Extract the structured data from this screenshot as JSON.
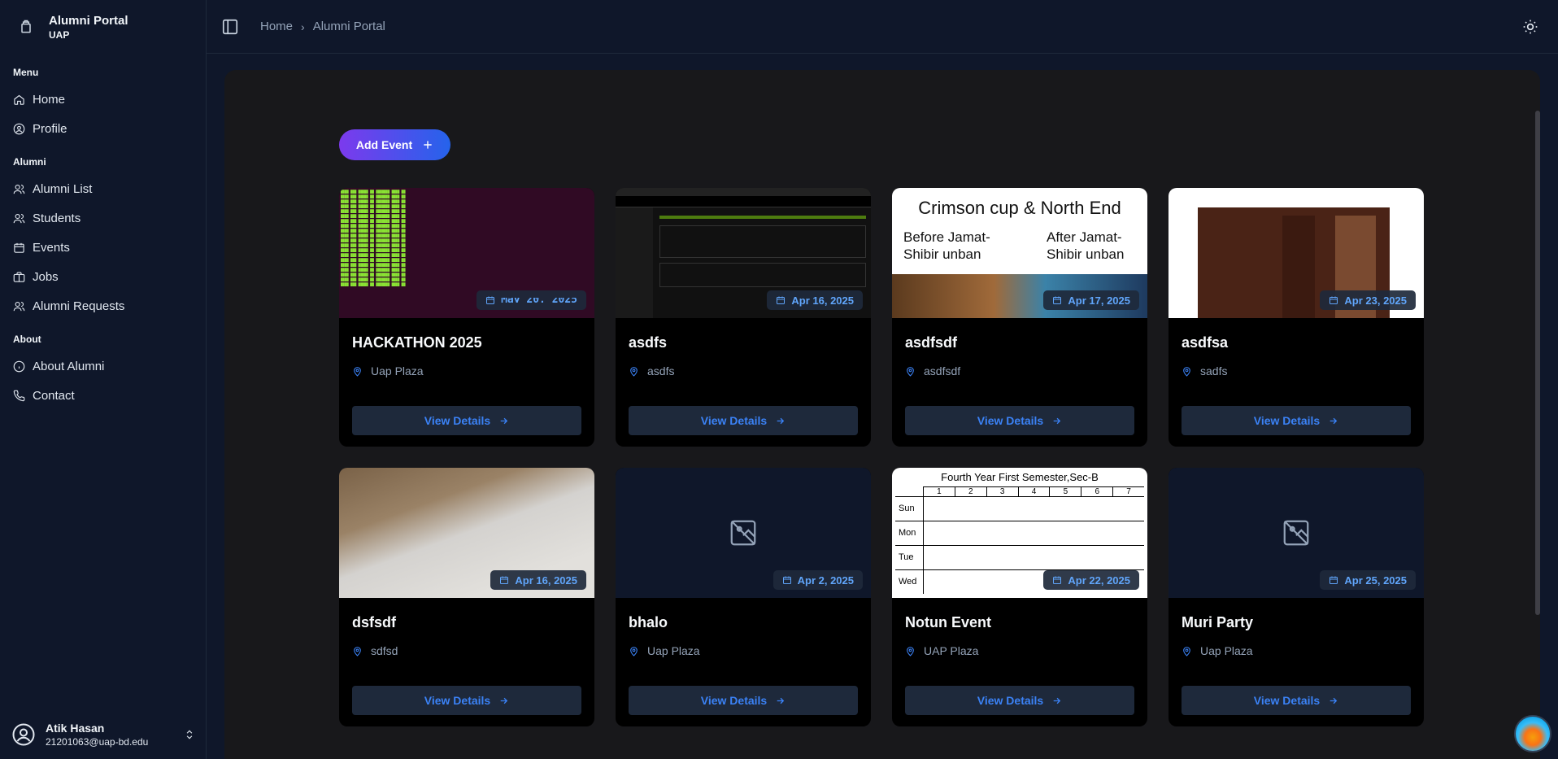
{
  "app": {
    "title": "Alumni Portal",
    "subtitle": "UAP"
  },
  "sidebar": {
    "groups": [
      {
        "label": "Menu",
        "items": [
          {
            "label": "Home",
            "icon": "home-icon"
          },
          {
            "label": "Profile",
            "icon": "user-circle-icon"
          }
        ]
      },
      {
        "label": "Alumni",
        "items": [
          {
            "label": "Alumni List",
            "icon": "users-icon"
          },
          {
            "label": "Students",
            "icon": "users-icon"
          },
          {
            "label": "Events",
            "icon": "calendar-icon"
          },
          {
            "label": "Jobs",
            "icon": "briefcase-icon"
          },
          {
            "label": "Alumni Requests",
            "icon": "users-icon"
          }
        ]
      },
      {
        "label": "About",
        "items": [
          {
            "label": "About Alumni",
            "icon": "info-icon"
          },
          {
            "label": "Contact",
            "icon": "phone-icon"
          }
        ]
      }
    ],
    "user": {
      "name": "Atik Hasan",
      "email": "21201063@uap-bd.edu"
    }
  },
  "breadcrumb": {
    "items": [
      "Home",
      "Alumni Portal"
    ],
    "separator": "›"
  },
  "main": {
    "add_button": "Add Event",
    "view_details_label": "View Details",
    "events": [
      {
        "title": "HACKATHON 2025",
        "location": "Uap Plaza",
        "date": "May 20, 2025",
        "thumb": "terminal"
      },
      {
        "title": "asdfs",
        "location": "asdfs",
        "date": "Apr 16, 2025",
        "thumb": "app"
      },
      {
        "title": "asdfsdf",
        "location": "asdfsdf",
        "date": "Apr 17, 2025",
        "thumb": "crimson"
      },
      {
        "title": "asdfsa",
        "location": "sadfs",
        "date": "Apr 23, 2025",
        "thumb": "furniture"
      },
      {
        "title": "dsfsdf",
        "location": "sdfsd",
        "date": "Apr 16, 2025",
        "thumb": "paper"
      },
      {
        "title": "bhalo",
        "location": "Uap Plaza",
        "date": "Apr 2, 2025",
        "thumb": "empty"
      },
      {
        "title": "Notun Event",
        "location": "UAP Plaza",
        "date": "Apr 22, 2025",
        "thumb": "table"
      },
      {
        "title": "Muri Party",
        "location": "Uap Plaza",
        "date": "Apr 25, 2025",
        "thumb": "empty"
      }
    ]
  },
  "thumbs": {
    "crimson": {
      "heading": "Crimson cup & North End",
      "left": "Before Jamat-Shibir unban",
      "right": "After Jamat-Shibir unban"
    },
    "table": {
      "heading": "Fourth Year First Semester,Sec-B",
      "cols": [
        "1",
        "2",
        "3",
        "4",
        "5",
        "6",
        "7"
      ],
      "days": [
        "Sun",
        "Mon",
        "Tue",
        "Wed"
      ]
    }
  },
  "colors": {
    "accent": "#3b82f6",
    "gradient_start": "#7c3aed",
    "gradient_end": "#2563eb",
    "bg": "#0f172a"
  }
}
